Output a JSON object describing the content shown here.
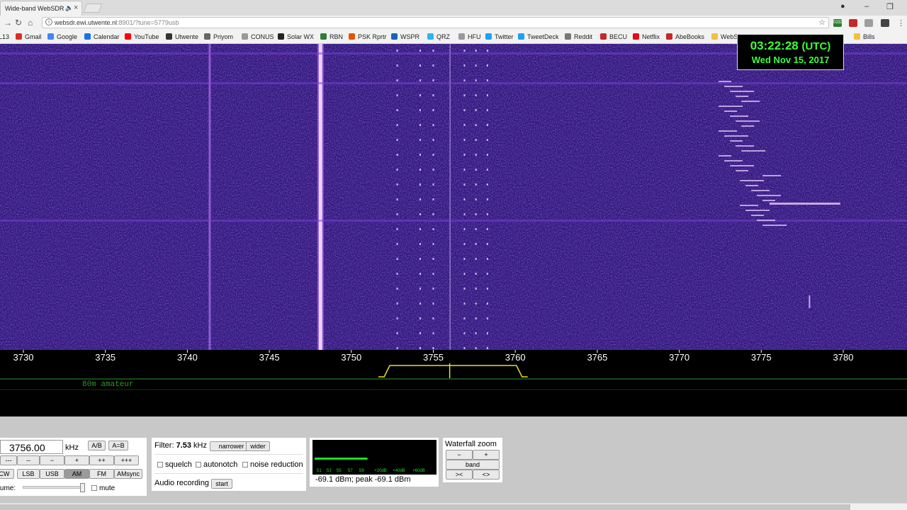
{
  "browser": {
    "tab_title": "Wide-band WebSDR",
    "url_host": "websdr.ewi.utwente.nl",
    "url_rest": ":8901/?tune=5779usb",
    "extension_badge": "0333"
  },
  "bookmarks": [
    {
      "label": "L13",
      "icon": "folder-icon",
      "color": "#f0c040"
    },
    {
      "label": "Gmail",
      "icon": "gmail-icon",
      "color": "#d93025"
    },
    {
      "label": "Google",
      "icon": "google-icon",
      "color": "#4285f4"
    },
    {
      "label": "Calendar",
      "icon": "calendar-icon",
      "color": "#1a73e8"
    },
    {
      "label": "YouTube",
      "icon": "youtube-icon",
      "color": "#ff0000"
    },
    {
      "label": "Utwente",
      "icon": "utwente-icon",
      "color": "#333333"
    },
    {
      "label": "Priyom",
      "icon": "antenna-icon",
      "color": "#666666"
    },
    {
      "label": "CONUS",
      "icon": "page-icon",
      "color": "#999999"
    },
    {
      "label": "Solar WX",
      "icon": "solar-icon",
      "color": "#222222"
    },
    {
      "label": "RBN",
      "icon": "rbn-icon",
      "color": "#2e7d32"
    },
    {
      "label": "PSK Rprtr",
      "icon": "psk-icon",
      "color": "#e65100"
    },
    {
      "label": "WSPR",
      "icon": "wspr-icon",
      "color": "#1565c0"
    },
    {
      "label": "QRZ",
      "icon": "globe-icon",
      "color": "#29b6f6"
    },
    {
      "label": "HFU",
      "icon": "page-icon",
      "color": "#999999"
    },
    {
      "label": "Twitter",
      "icon": "twitter-icon",
      "color": "#1da1f2"
    },
    {
      "label": "TweetDeck",
      "icon": "tweetdeck-icon",
      "color": "#1da1f2"
    },
    {
      "label": "Reddit",
      "icon": "reddit-icon",
      "color": "#777777"
    },
    {
      "label": "BECU",
      "icon": "becu-icon",
      "color": "#c62828"
    },
    {
      "label": "Netflix",
      "icon": "netflix-icon",
      "color": "#e50914"
    },
    {
      "label": "AbeBooks",
      "icon": "abebooks-icon",
      "color": "#c62828"
    },
    {
      "label": "WebS",
      "icon": "folder-icon",
      "color": "#f0c040"
    },
    {
      "label": "Bills",
      "icon": "folder-icon",
      "color": "#f0c040"
    }
  ],
  "clock": {
    "time": "03:22:28",
    "utc": "(UTC)",
    "date": "Wed Nov 15, 2017"
  },
  "scale": {
    "ticks": [
      "3730",
      "3735",
      "3740",
      "3745",
      "3750",
      "3755",
      "3760",
      "3765",
      "3770",
      "3775",
      "3780"
    ],
    "band_label": "80m amateur",
    "passband_low_khz": 3752.0,
    "passband_high_khz": 3760.5,
    "tuned_khz": 3756.0
  },
  "tuning": {
    "frequency": "3756.00",
    "unit": "kHz",
    "ab": "A/B",
    "aeqb": "A=B",
    "step_buttons": [
      "---",
      "--",
      "−",
      "+",
      "++",
      "+++"
    ],
    "modes": [
      "CW",
      "LSB",
      "USB",
      "AM",
      "FM",
      "AMsync"
    ],
    "selected_mode": "AM",
    "volume_label": "Volume:",
    "volume_level": 0.95,
    "mute_label": "mute"
  },
  "filter": {
    "label": "Filter:",
    "value": "7.53",
    "unit": "kHz",
    "narrower": "narrower",
    "wider": "wider",
    "squelch": "squelch",
    "autonotch": "autonotch",
    "noise_reduction": "noise reduction",
    "recording_label": "Audio recording",
    "start": "start"
  },
  "smeter": {
    "scale": [
      "S1",
      "S3",
      "S5",
      "S7",
      "S9",
      "+20dB",
      "+40dB",
      "+60dB"
    ],
    "level_fraction": 0.45,
    "reading": "-69.1 dBm; peak  -69.1 dBm"
  },
  "zoom": {
    "title": "Waterfall zoom",
    "minus": "−",
    "plus": "+",
    "band": "band",
    "zoom_out": "><",
    "zoom_in": "<>"
  },
  "colors": {
    "waterfall_bg": "#2e1a7a",
    "signal": "#f0d0ff",
    "scale_green": "#2a9a2a",
    "passband": "#e6dc3c",
    "clock_text": "#3cff3c"
  }
}
